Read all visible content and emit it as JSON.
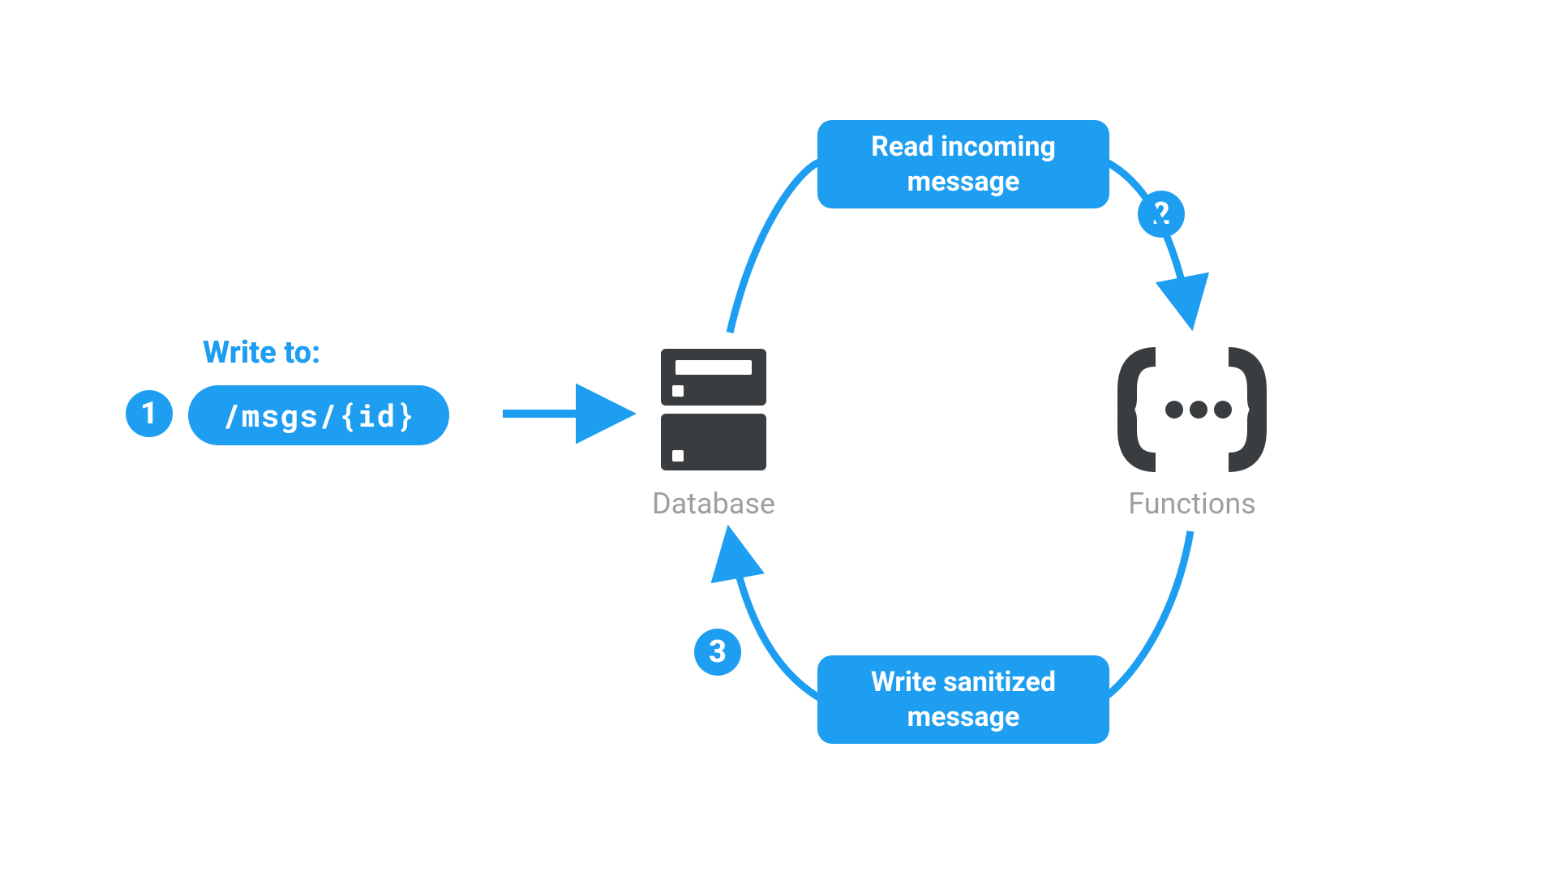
{
  "colors": {
    "accent": "#1e9ef0",
    "icon": "#3a3d40",
    "muted": "#9e9e9e"
  },
  "write_label": "Write to:",
  "path": "/msgs/{id}",
  "steps": {
    "one": "1",
    "two": "2",
    "three": "3"
  },
  "flow_top_line1": "Read incoming",
  "flow_top_line2": "message",
  "flow_bottom_line1": "Write sanitized",
  "flow_bottom_line2": "message",
  "nodes": {
    "database": "Database",
    "functions": "Functions"
  }
}
